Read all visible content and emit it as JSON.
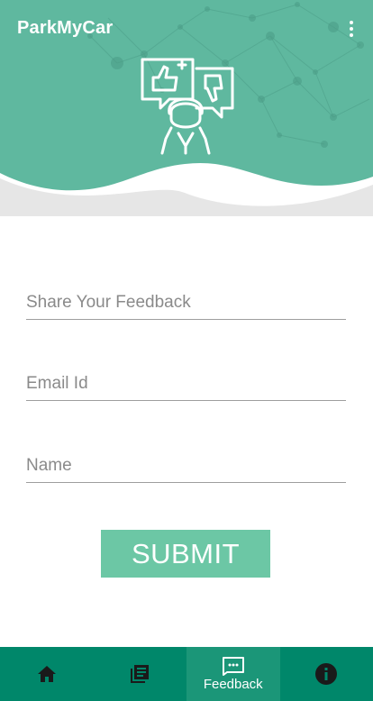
{
  "app": {
    "title": "ParkMyCar"
  },
  "form": {
    "feedback_placeholder": "Share Your Feedback",
    "email_placeholder": "Email Id",
    "name_placeholder": "Name",
    "submit_label": "SUBMIT"
  },
  "bottom_nav": {
    "items": [
      {
        "icon": "home-icon",
        "label": ""
      },
      {
        "icon": "library-icon",
        "label": ""
      },
      {
        "icon": "feedback-icon",
        "label": "Feedback",
        "active": true
      },
      {
        "icon": "info-icon",
        "label": ""
      }
    ]
  },
  "colors": {
    "accent": "#5fb89f",
    "button": "#6cc7a5",
    "nav_bar": "#00876a"
  }
}
